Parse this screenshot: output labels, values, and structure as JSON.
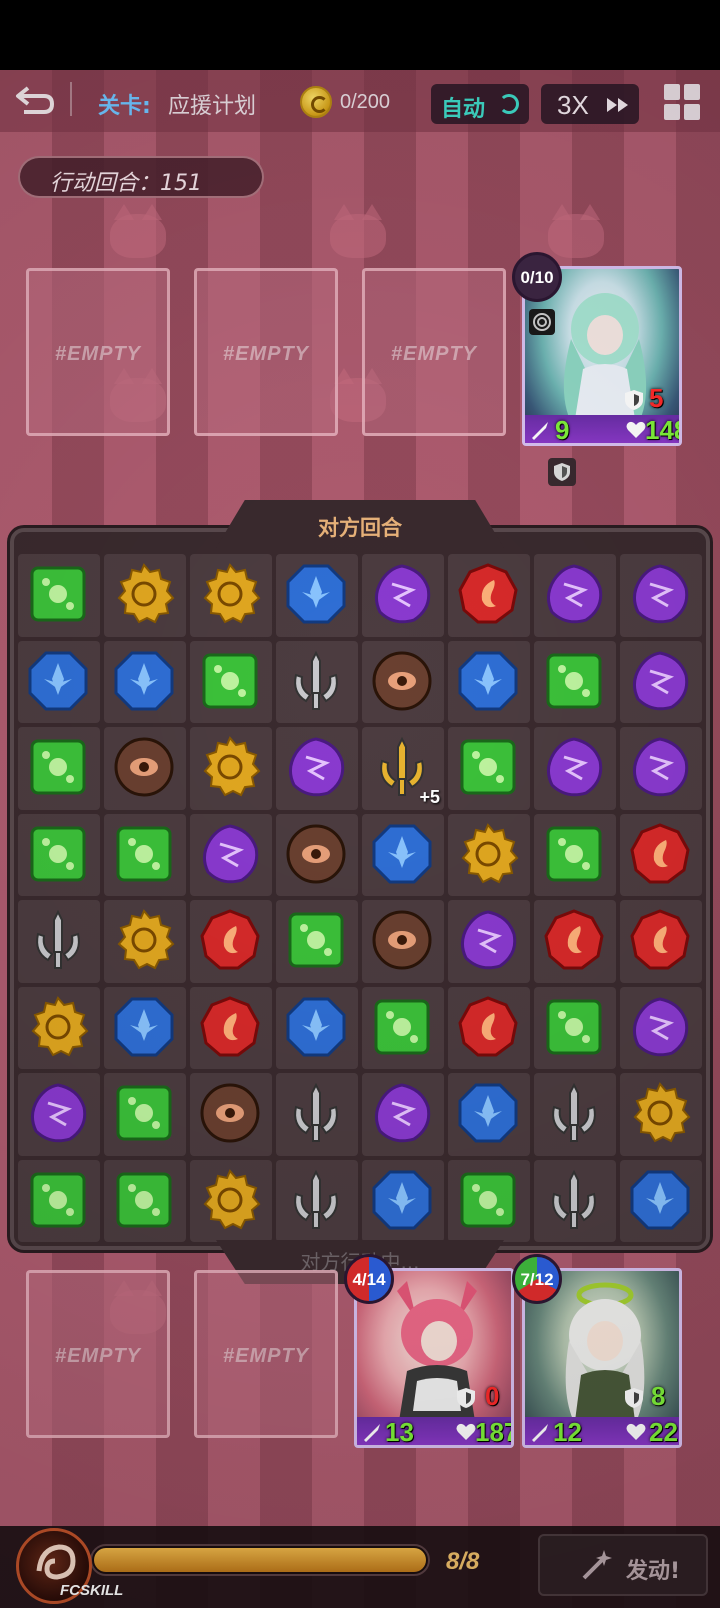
{
  "topbar": {
    "stage_label": "关卡:",
    "stage_name": "应援计划",
    "coin_count": "0/200",
    "auto_label": "自动",
    "speed_label": "3X"
  },
  "turn": {
    "label": "行动回合：151"
  },
  "slots": {
    "empty_label": "#EMPTY"
  },
  "enemy_card": {
    "badge": "0/10",
    "attack": "9",
    "shield": "5",
    "hp": "148"
  },
  "player_cards": [
    {
      "badge": "4/14",
      "attack": "13",
      "shield": "0",
      "hp": "187"
    },
    {
      "badge": "7/12",
      "attack": "12",
      "shield": "8",
      "hp": "22"
    }
  ],
  "board": {
    "title": "对方回合",
    "status": "对方行动中...",
    "bonus_label": "+5",
    "rows": [
      [
        "green",
        "gold",
        "gold",
        "blue",
        "purple",
        "red",
        "purple",
        "purple"
      ],
      [
        "blue",
        "blue",
        "green",
        "sword",
        "brown",
        "blue",
        "green",
        "purple"
      ],
      [
        "green",
        "brown",
        "gold",
        "purple",
        "sword-gold",
        "green",
        "purple",
        "purple"
      ],
      [
        "green",
        "green",
        "purple",
        "brown",
        "blue",
        "gold",
        "green",
        "red"
      ],
      [
        "sword",
        "gold",
        "red",
        "green",
        "brown",
        "purple",
        "red",
        "red"
      ],
      [
        "gold",
        "blue",
        "red",
        "blue",
        "green",
        "red",
        "green",
        "purple"
      ],
      [
        "purple",
        "green",
        "brown",
        "sword",
        "purple",
        "blue",
        "sword",
        "gold"
      ],
      [
        "green",
        "green",
        "gold",
        "sword",
        "blue",
        "green",
        "sword",
        "blue"
      ]
    ]
  },
  "colors": {
    "green": "#3cc23a",
    "gold": "#e2a820",
    "blue": "#2f6fd6",
    "purple": "#8a3ad0",
    "red": "#d82a2a",
    "brown": "#6a4030",
    "sword": "#c8c8cc",
    "sword-gold": "#e8b430"
  },
  "bottom": {
    "fcskill_label": "FCSKILL",
    "energy_count": "8/8",
    "energy_fill": 1.0,
    "launch_label": "发动!"
  }
}
